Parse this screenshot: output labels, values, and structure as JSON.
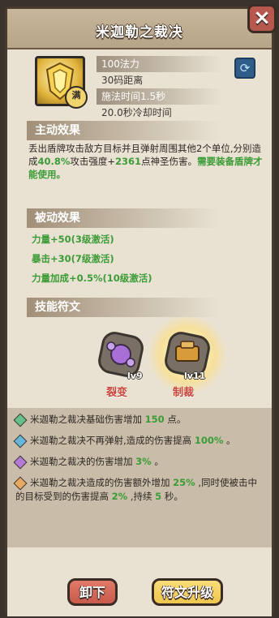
{
  "title": "米迦勒之裁决",
  "skill": {
    "badge": "满",
    "mana": "100法力",
    "range": "30码距离",
    "cast": "施法时间1.5秒",
    "cooldown": "20.0秒冷却时间"
  },
  "active": {
    "header": "主动效果",
    "text_parts": [
      "丢出盾牌攻击敌方目标并且弹射周围其他2个单位,分别造成",
      "40.8%",
      "攻击强度+",
      "2361",
      "点神圣伤害。",
      "需要装备盾牌才能使用。"
    ]
  },
  "passive": {
    "header": "被动效果",
    "items": [
      "力量+50(3级激活)",
      "暴击+30(7级激活)",
      "力量加成+0.5%(10级激活)"
    ]
  },
  "runes": {
    "header": "技能符文",
    "items": [
      {
        "name": "裂变",
        "level": "lv9",
        "color": "#a86fd6"
      },
      {
        "name": "制裁",
        "level": "lv11",
        "color": "#d79b3a"
      }
    ]
  },
  "effects": [
    {
      "gem_color": "#66c08a",
      "parts": [
        "米迦勒之裁决基础伤害增加 ",
        "150",
        " 点。"
      ]
    },
    {
      "gem_color": "#66b6d9",
      "parts": [
        "米迦勒之裁决不再弹射,造成的伤害提高 ",
        "100%",
        " 。"
      ]
    },
    {
      "gem_color": "#b47ad6",
      "parts": [
        "米迦勒之裁决的伤害增加 ",
        "3%",
        " 。"
      ]
    },
    {
      "gem_color": "#e8a863",
      "parts": [
        "米迦勒之裁决造成的伤害额外增加 ",
        "25%",
        " ,同时使被击中的目标受到的伤害提高 ",
        "2%",
        " ,持续 ",
        "5",
        " 秒。"
      ]
    }
  ],
  "buttons": {
    "unequip": "卸下",
    "upgrade": "符文升级"
  },
  "colors": {
    "accent_green": "#3b9c36",
    "close_bg": "#b7584f",
    "unequip_bg": "#c85a4b",
    "upgrade_bg": "#efc64e"
  }
}
